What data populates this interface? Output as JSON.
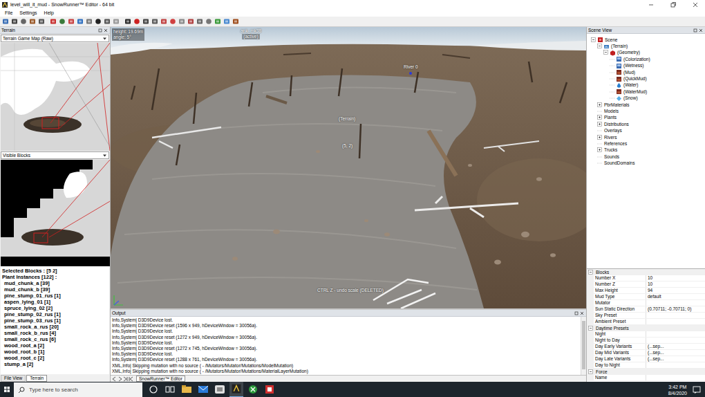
{
  "window": {
    "title": "level_will_it_mud - SnowRunner™ Editor - 64 bit"
  },
  "menu": [
    "File",
    "Settings",
    "Help"
  ],
  "left_panel": {
    "title": "Terrain",
    "map_dropdown": "Terrain Game Map (Raw)",
    "blocks_dropdown": "Visible Blocks",
    "selected_blocks": "Selected Blocks : [5 2]",
    "plant_header": "Plant Instances [122] :",
    "plants": [
      "mud_chunk_a [39]",
      "mud_chunk_b [39]",
      "pine_stump_01_rus [1]",
      "aspen_lying_01 [1]",
      "spruce_lying_02 [2]",
      "pine_stump_02_rus [1]",
      "pine_stump_03_rus [1]",
      "small_rock_a_rus [20]",
      "small_rock_b_rus [4]",
      "small_rock_c_rus [6]",
      "wood_root_a [2]",
      "wood_root_b [1]",
      "wood_root_c [2]",
      "stump_a [2]"
    ],
    "tabs": [
      {
        "label": "File View",
        "selected": false
      },
      {
        "label": "Terrain",
        "selected": true
      }
    ]
  },
  "viewport": {
    "height": "height: 19.69m",
    "angle": "angle: 5°",
    "truck": "ank_mk38",
    "truck_state": "(active)",
    "labels": [
      "River 0",
      "(Terrain)",
      "(5, 2)"
    ],
    "hint": "CTRL Z - undo scale (DELETED)"
  },
  "output": {
    "title": "Output",
    "lines": [
      "Info,System| D3D9Device lost.",
      "Info,System| D3D9Device reset (1596 x 949, hDeviceWindow = 30056a).",
      "Info,System| D3D9Device lost.",
      "Info,System| D3D9Device reset (1272 x 949, hDeviceWindow = 30056a).",
      "Info,System| D3D9Device lost.",
      "Info,System| D3D9Device reset (1272 x 745, hDeviceWindow = 30056a).",
      "Info,System| D3D9Device lost.",
      "Info,System| D3D9Device reset (1288 x 761, hDeviceWindow = 30056a).",
      "XML,Info| Skipping mutation with no source ( - /Mutators/Mutator/Mutations/ModelMutation)",
      "XML,Info| Skipping mutation with no source ( - /Mutators/Mutator/Mutations/MaterialLayerMutation)"
    ]
  },
  "doc_tabs": [
    {
      "label": "SnowRunner™ Editor",
      "selected": true
    }
  ],
  "scene_view": {
    "title": "Scene View",
    "tree": [
      {
        "label": "Scene",
        "depth": 0,
        "kind": "scene",
        "expandable": true,
        "expanded": true
      },
      {
        "label": "(Terrain)",
        "depth": 1,
        "kind": "terrain",
        "expandable": true,
        "expanded": true
      },
      {
        "label": "(Geometry)",
        "depth": 2,
        "kind": "geometry",
        "expandable": true,
        "expanded": true
      },
      {
        "label": "(Colorization)",
        "depth": 3,
        "kind": "layer",
        "expandable": false,
        "expanded": false
      },
      {
        "label": "(Wetness)",
        "depth": 3,
        "kind": "layer",
        "expandable": false,
        "expanded": false
      },
      {
        "label": "(Mud)",
        "depth": 3,
        "kind": "mud",
        "expandable": false,
        "expanded": false
      },
      {
        "label": "(QuickMud)",
        "depth": 3,
        "kind": "mud",
        "expandable": false,
        "expanded": false
      },
      {
        "label": "(Water)",
        "depth": 3,
        "kind": "water",
        "expandable": false,
        "expanded": false
      },
      {
        "label": "(WaterMud)",
        "depth": 3,
        "kind": "mud",
        "expandable": false,
        "expanded": false
      },
      {
        "label": "(Snow)",
        "depth": 3,
        "kind": "snow",
        "expandable": false,
        "expanded": false
      },
      {
        "label": "PbrMaterials",
        "depth": 1,
        "kind": "none",
        "expandable": true,
        "expanded": false
      },
      {
        "label": "Models",
        "depth": 1,
        "kind": "none",
        "expandable": false,
        "expanded": false
      },
      {
        "label": "Plants",
        "depth": 1,
        "kind": "none",
        "expandable": true,
        "expanded": false
      },
      {
        "label": "Distributions",
        "depth": 1,
        "kind": "none",
        "expandable": true,
        "expanded": false
      },
      {
        "label": "Overlays",
        "depth": 1,
        "kind": "none",
        "expandable": false,
        "expanded": false
      },
      {
        "label": "Rivers",
        "depth": 1,
        "kind": "none",
        "expandable": true,
        "expanded": false
      },
      {
        "label": "References",
        "depth": 1,
        "kind": "none",
        "expandable": false,
        "expanded": false
      },
      {
        "label": "Trucks",
        "depth": 1,
        "kind": "none",
        "expandable": true,
        "expanded": false
      },
      {
        "label": "Sounds",
        "depth": 1,
        "kind": "none",
        "expandable": false,
        "expanded": false
      },
      {
        "label": "SoundDomains",
        "depth": 1,
        "kind": "none",
        "expandable": false,
        "expanded": false
      }
    ]
  },
  "properties": [
    {
      "kind": "group",
      "label": "Blocks",
      "expanded": true
    },
    {
      "kind": "prop",
      "label": "Number X",
      "value": "10"
    },
    {
      "kind": "prop",
      "label": "Number Z",
      "value": "10"
    },
    {
      "kind": "prop",
      "label": "Max Height",
      "value": "94"
    },
    {
      "kind": "prop",
      "label": "Mud Type",
      "value": "default"
    },
    {
      "kind": "prop",
      "label": "Mutator"
    },
    {
      "kind": "prop",
      "label": "Sun Static Direction",
      "value": "(0.70711; -0.70711; 0)"
    },
    {
      "kind": "prop",
      "label": "Sky Preset"
    },
    {
      "kind": "prop",
      "label": "Ambient Preset"
    },
    {
      "kind": "group",
      "label": "Daytime Presets",
      "expanded": true
    },
    {
      "kind": "prop",
      "label": "Night"
    },
    {
      "kind": "prop",
      "label": "Night to Day"
    },
    {
      "kind": "prop",
      "label": "Day Early Variants",
      "value": "(...sep..."
    },
    {
      "kind": "prop",
      "label": "Day Mid Variants",
      "value": "(...sep..."
    },
    {
      "kind": "prop",
      "label": "Day Late Variants",
      "value": "(...sep..."
    },
    {
      "kind": "prop",
      "label": "Day to Night"
    },
    {
      "kind": "group",
      "label": "Force",
      "expanded": true
    },
    {
      "kind": "prop",
      "label": "Name"
    }
  ],
  "taskbar": {
    "search_placeholder": "Type here to search",
    "time": "3:42 PM",
    "date": "8/4/2020"
  }
}
